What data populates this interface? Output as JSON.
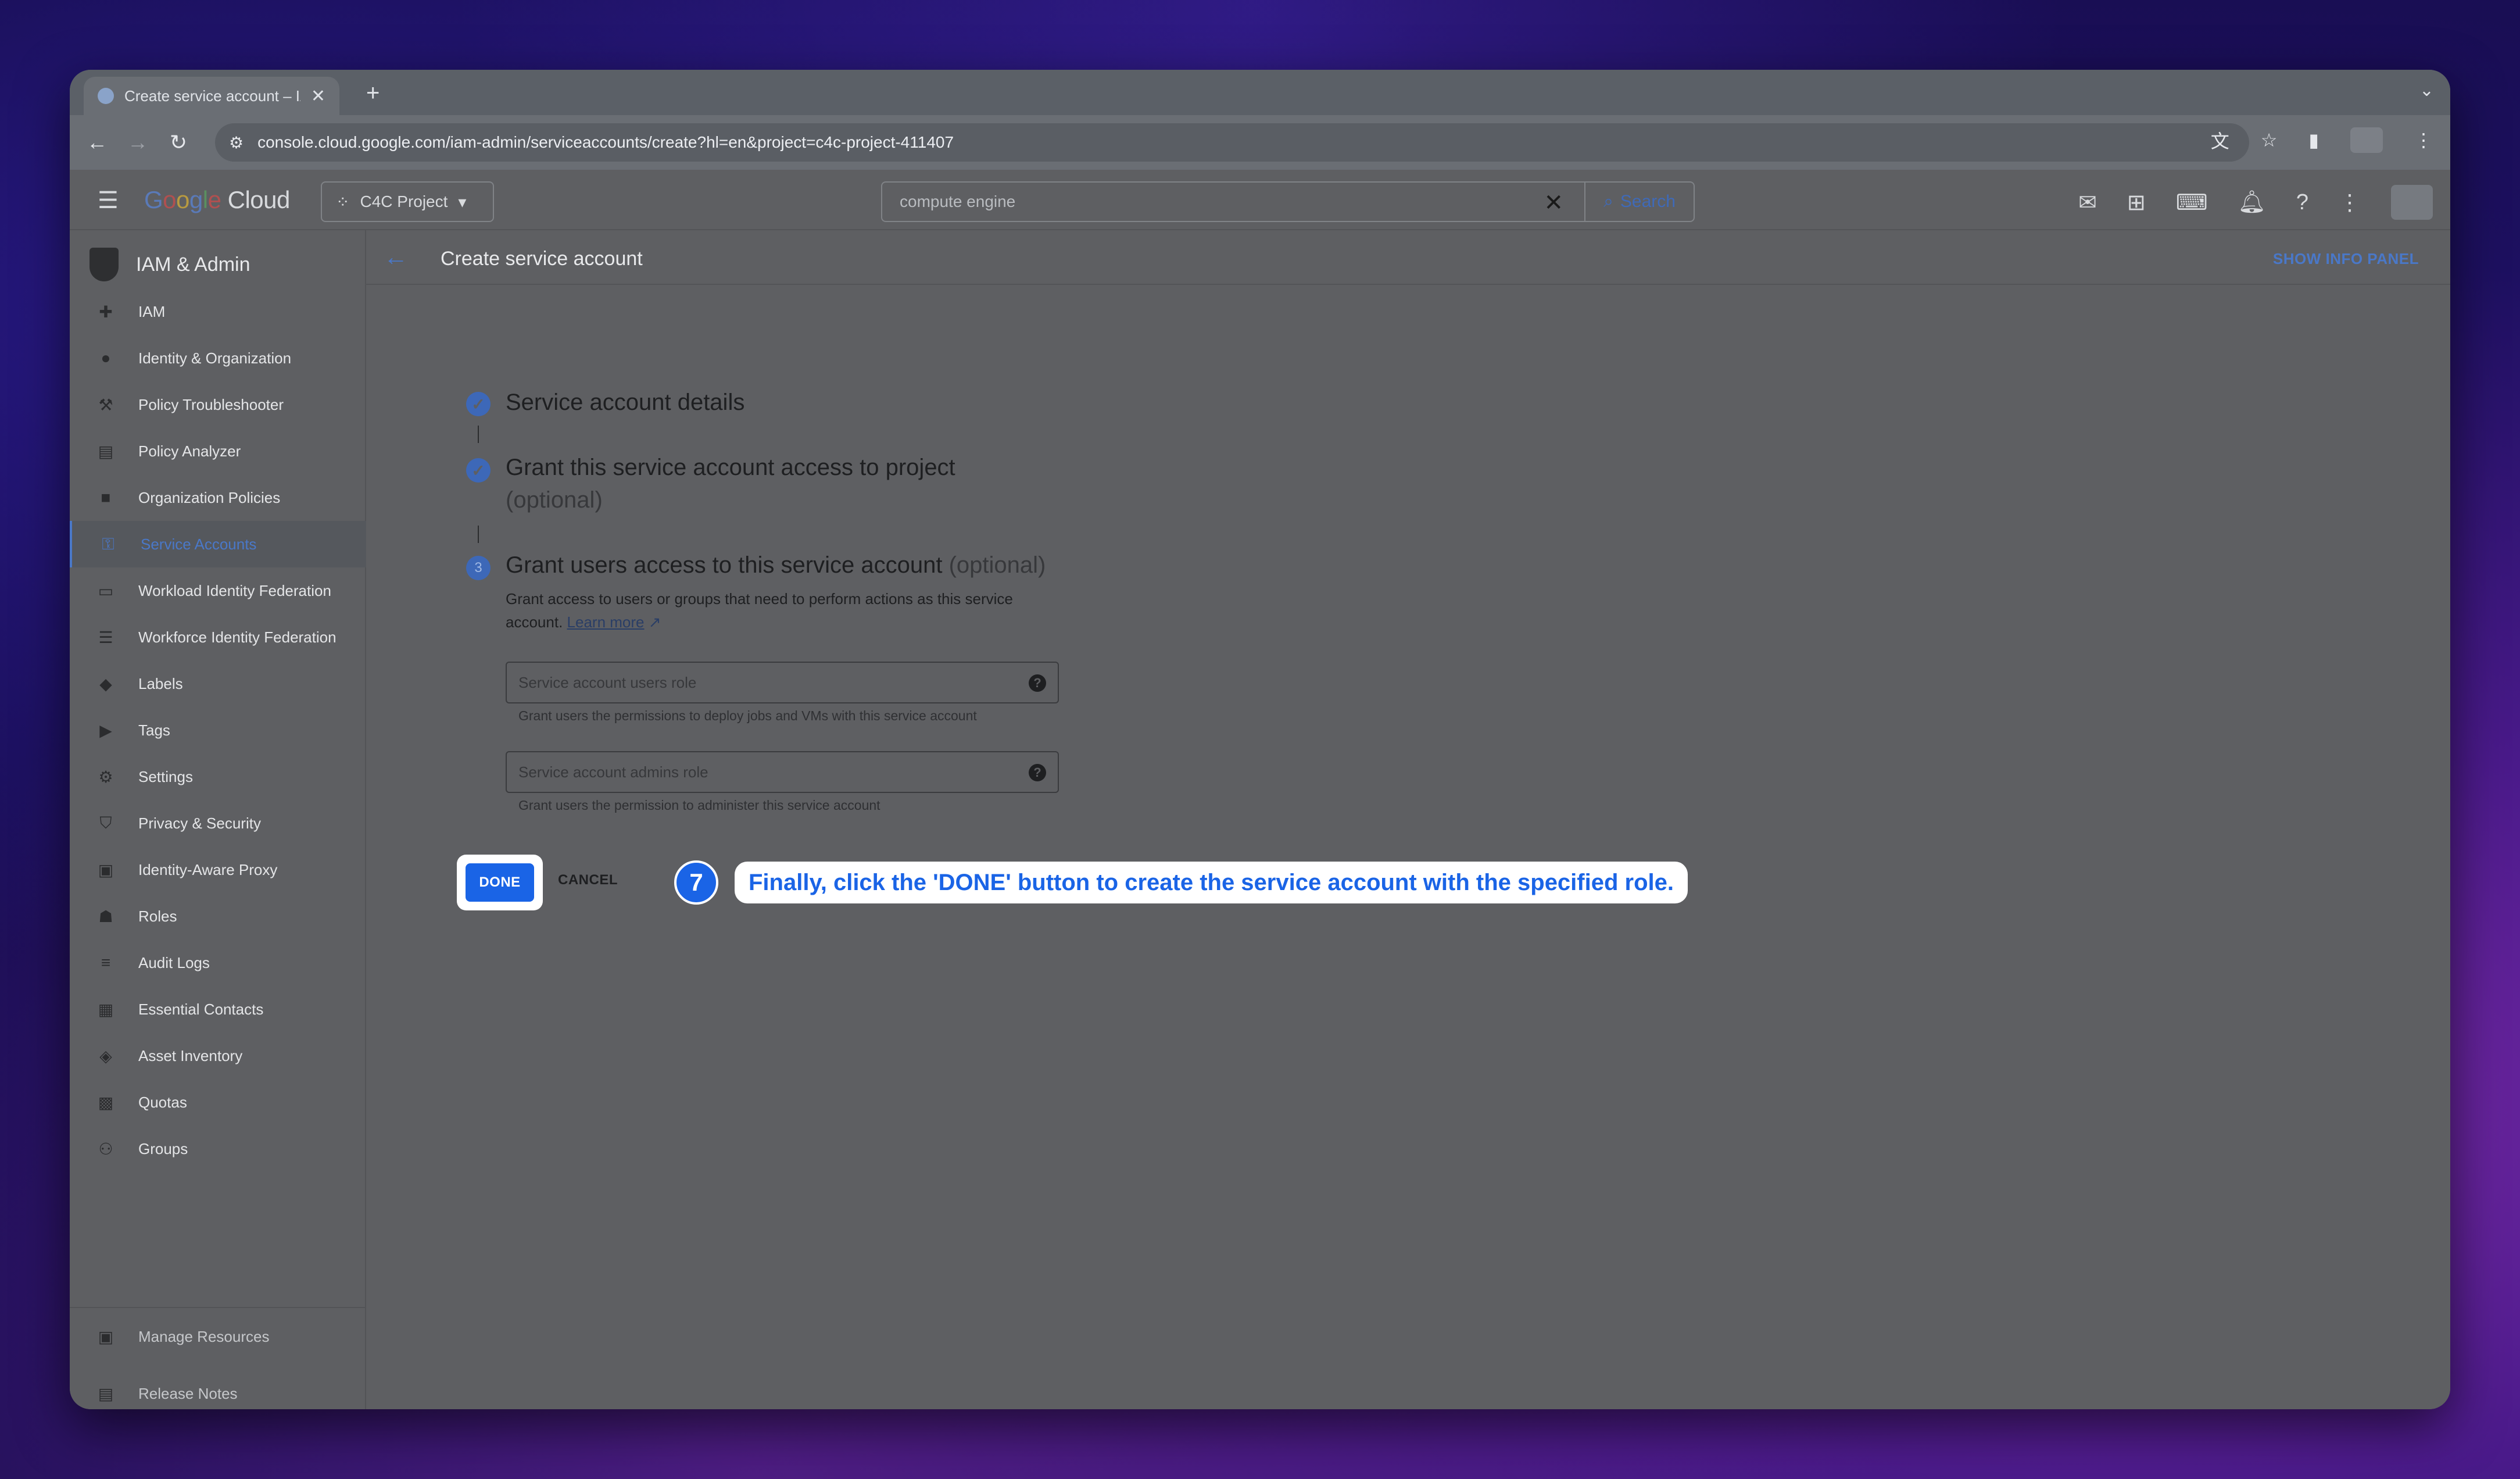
{
  "browser": {
    "tab_title": "Create service account – IAM",
    "tab_close": "✕",
    "new_tab": "+",
    "url": "console.cloud.google.com/iam-admin/serviceaccounts/create?hl=en&project=c4c-project-411407"
  },
  "header": {
    "logo_parts": [
      "G",
      "o",
      "o",
      "g",
      "l",
      "e"
    ],
    "logo_suffix": " Cloud",
    "project": "C4C Project",
    "search_value": "compute engine",
    "search_button": "Search"
  },
  "sidebar": {
    "title": "IAM & Admin",
    "items": [
      {
        "label": "IAM",
        "icon": "person-add-icon"
      },
      {
        "label": "Identity & Organization",
        "icon": "account-circle-icon"
      },
      {
        "label": "Policy Troubleshooter",
        "icon": "wrench-icon"
      },
      {
        "label": "Policy Analyzer",
        "icon": "doc-search-icon"
      },
      {
        "label": "Organization Policies",
        "icon": "list-box-icon"
      },
      {
        "label": "Service Accounts",
        "icon": "service-account-icon"
      },
      {
        "label": "Workload Identity Federation",
        "icon": "id-card-icon"
      },
      {
        "label": "Workforce Identity Federation",
        "icon": "list-icon"
      },
      {
        "label": "Labels",
        "icon": "label-icon"
      },
      {
        "label": "Tags",
        "icon": "tag-icon"
      },
      {
        "label": "Settings",
        "icon": "gear-icon"
      },
      {
        "label": "Privacy & Security",
        "icon": "shield-icon"
      },
      {
        "label": "Identity-Aware Proxy",
        "icon": "proxy-icon"
      },
      {
        "label": "Roles",
        "icon": "hat-icon"
      },
      {
        "label": "Audit Logs",
        "icon": "lines-icon"
      },
      {
        "label": "Essential Contacts",
        "icon": "contacts-icon"
      },
      {
        "label": "Asset Inventory",
        "icon": "diamond-icon"
      },
      {
        "label": "Quotas",
        "icon": "quota-icon"
      },
      {
        "label": "Groups",
        "icon": "groups-icon"
      }
    ],
    "active_index": 5,
    "bottom": [
      {
        "label": "Manage Resources",
        "icon": "folder-gear-icon"
      },
      {
        "label": "Release Notes",
        "icon": "notes-icon"
      }
    ],
    "collapse": "<|"
  },
  "main": {
    "title": "Create service account",
    "info_panel": "SHOW INFO PANEL",
    "step1_title": "Service account details",
    "step2_title": "Grant this service account access to project",
    "step2_optional": "(optional)",
    "step3_number": "3",
    "step3_title": "Grant users access to this service account",
    "step3_optional": "(optional)",
    "step3_desc": "Grant access to users or groups that need to perform actions as this service account.",
    "learn_more": "Learn more",
    "users_role_placeholder": "Service account users role",
    "users_role_hint": "Grant users the permissions to deploy jobs and VMs with this service account",
    "admins_role_placeholder": "Service account admins role",
    "admins_role_hint": "Grant users the permission to administer this service account",
    "done": "DONE",
    "cancel": "CANCEL"
  },
  "callout": {
    "number": "7",
    "text": "Finally, click the 'DONE' button to create the service account with the specified role."
  }
}
